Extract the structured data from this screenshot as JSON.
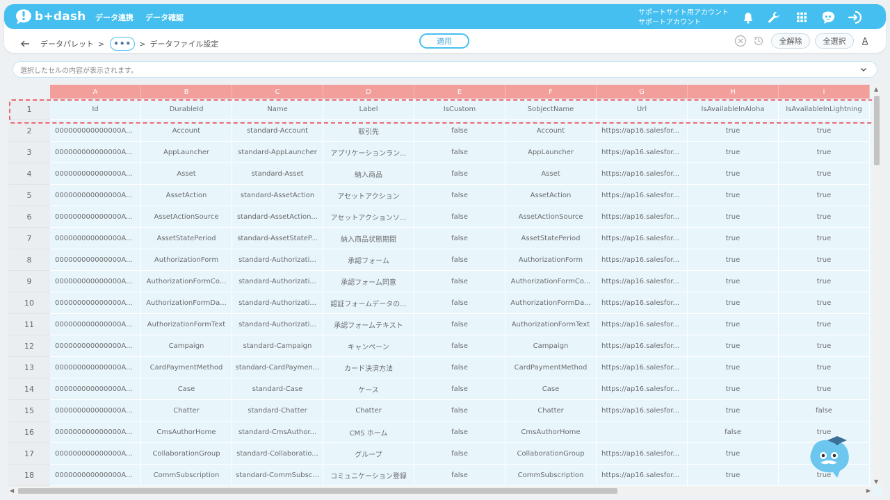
{
  "app": {
    "logo_text": "b+dash"
  },
  "nav": {
    "data_integration": "データ連携",
    "data_check": "データ確認"
  },
  "account": {
    "line1": "サポートサイト用アカウント",
    "line2": "サポートアカウント"
  },
  "breadcrumb": {
    "first": "データパレット",
    "sep1": ">",
    "ellipsis": "•••",
    "sep2": ">",
    "current": "データファイル設定"
  },
  "toolbar": {
    "apply": "適用",
    "clear_all": "全解除",
    "select_all": "全選択",
    "font_a": "A"
  },
  "cellbar": {
    "placeholder": "選択したセルの内容が表示されます。"
  },
  "columns": [
    "A",
    "B",
    "C",
    "D",
    "E",
    "F",
    "G",
    "H",
    "I"
  ],
  "rows": [
    {
      "num": "1",
      "cells": [
        "Id",
        "DurableId",
        "Name",
        "Label",
        "IsCustom",
        "SobjectName",
        "Url",
        "IsAvailableInAloha",
        "IsAvailableInLightning"
      ]
    },
    {
      "num": "2",
      "cells": [
        "000000000000000A...",
        "Account",
        "standard-Account",
        "取引先",
        "false",
        "Account",
        "https://ap16.salesfor...",
        "true",
        "true"
      ]
    },
    {
      "num": "3",
      "cells": [
        "000000000000000A...",
        "AppLauncher",
        "standard-AppLauncher",
        "アプリケーションラン...",
        "false",
        "AppLauncher",
        "https://ap16.salesfor...",
        "true",
        "true"
      ]
    },
    {
      "num": "4",
      "cells": [
        "000000000000000A...",
        "Asset",
        "standard-Asset",
        "納入商品",
        "false",
        "Asset",
        "https://ap16.salesfor...",
        "true",
        "true"
      ]
    },
    {
      "num": "5",
      "cells": [
        "000000000000000A...",
        "AssetAction",
        "standard-AssetAction",
        "アセットアクション",
        "false",
        "AssetAction",
        "https://ap16.salesfor...",
        "true",
        "true"
      ]
    },
    {
      "num": "6",
      "cells": [
        "000000000000000A...",
        "AssetActionSource",
        "standard-AssetAction...",
        "アセットアクションソ...",
        "false",
        "AssetActionSource",
        "https://ap16.salesfor...",
        "true",
        "true"
      ]
    },
    {
      "num": "7",
      "cells": [
        "000000000000000A...",
        "AssetStatePeriod",
        "standard-AssetStateP...",
        "納入商品状態期間",
        "false",
        "AssetStatePeriod",
        "https://ap16.salesfor...",
        "true",
        "true"
      ]
    },
    {
      "num": "8",
      "cells": [
        "000000000000000A...",
        "AuthorizationForm",
        "standard-Authorizati...",
        "承認フォーム",
        "false",
        "AuthorizationForm",
        "https://ap16.salesfor...",
        "true",
        "true"
      ]
    },
    {
      "num": "9",
      "cells": [
        "000000000000000A...",
        "AuthorizationFormCo...",
        "standard-Authorizati...",
        "承認フォーム同意",
        "false",
        "AuthorizationFormCo...",
        "https://ap16.salesfor...",
        "true",
        "true"
      ]
    },
    {
      "num": "10",
      "cells": [
        "000000000000000A...",
        "AuthorizationFormDa...",
        "standard-Authorizati...",
        "認証フォームデータの...",
        "false",
        "AuthorizationFormDa...",
        "https://ap16.salesfor...",
        "true",
        "true"
      ]
    },
    {
      "num": "11",
      "cells": [
        "000000000000000A...",
        "AuthorizationFormText",
        "standard-Authorizati...",
        "承認フォームテキスト",
        "false",
        "AuthorizationFormText",
        "https://ap16.salesfor...",
        "true",
        "true"
      ]
    },
    {
      "num": "12",
      "cells": [
        "000000000000000A...",
        "Campaign",
        "standard-Campaign",
        "キャンペーン",
        "false",
        "Campaign",
        "https://ap16.salesfor...",
        "true",
        "true"
      ]
    },
    {
      "num": "13",
      "cells": [
        "000000000000000A...",
        "CardPaymentMethod",
        "standard-CardPaymen...",
        "カード決済方法",
        "false",
        "CardPaymentMethod",
        "https://ap16.salesfor...",
        "true",
        "true"
      ]
    },
    {
      "num": "14",
      "cells": [
        "000000000000000A...",
        "Case",
        "standard-Case",
        "ケース",
        "false",
        "Case",
        "https://ap16.salesfor...",
        "true",
        "true"
      ]
    },
    {
      "num": "15",
      "cells": [
        "000000000000000A...",
        "Chatter",
        "standard-Chatter",
        "Chatter",
        "false",
        "Chatter",
        "https://ap16.salesfor...",
        "true",
        "false"
      ]
    },
    {
      "num": "16",
      "cells": [
        "000000000000000A...",
        "CmsAuthorHome",
        "standard-CmsAuthor...",
        "CMS ホーム",
        "false",
        "CmsAuthorHome",
        "",
        "false",
        "true"
      ]
    },
    {
      "num": "17",
      "cells": [
        "000000000000000A...",
        "CollaborationGroup",
        "standard-Collaboratio...",
        "グループ",
        "false",
        "CollaborationGroup",
        "https://ap16.salesfor...",
        "true",
        "true"
      ]
    },
    {
      "num": "18",
      "cells": [
        "000000000000000A...",
        "CommSubscription",
        "standard-CommSubsc...",
        "コミュニケーション登録",
        "false",
        "CommSubscription",
        "https://ap16.salesfor...",
        "true",
        "true"
      ]
    }
  ],
  "colors": {
    "brand": "#44bfef",
    "header_red": "#f29f9b",
    "cell_bg": "#e8f6fc",
    "selection_dash": "#ea6a72"
  }
}
